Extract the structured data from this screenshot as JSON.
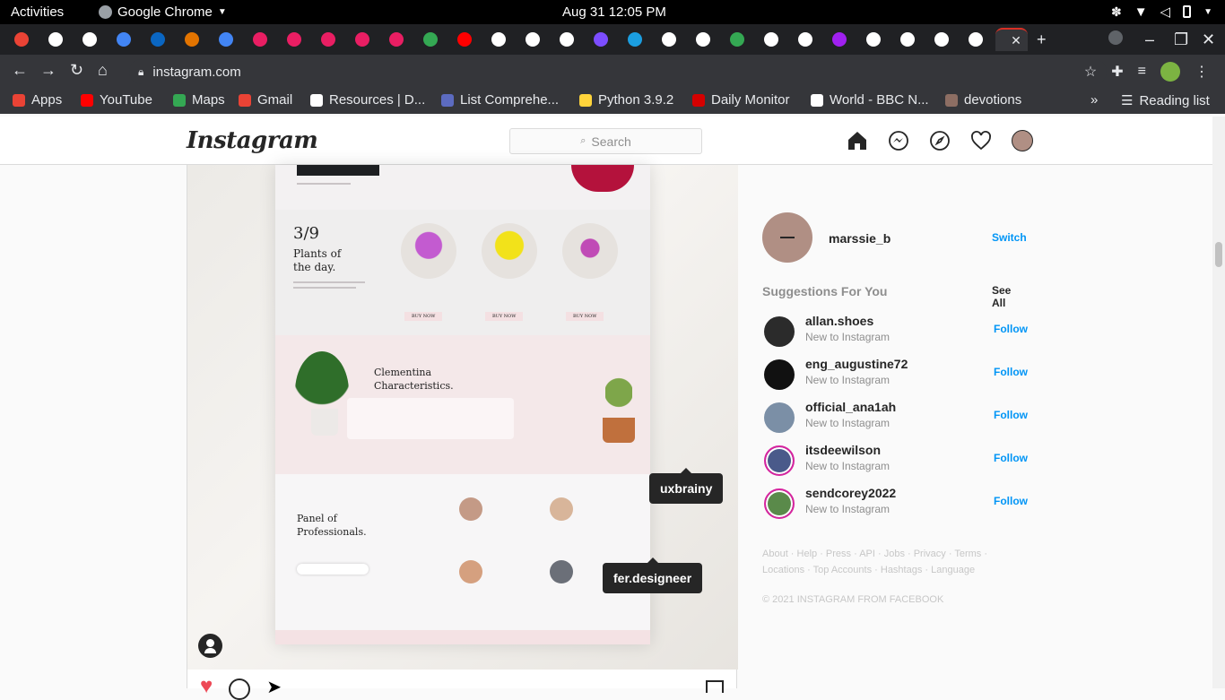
{
  "system": {
    "activities": "Activities",
    "app_name": "Google Chrome",
    "clock": "Aug 31  12:05 PM"
  },
  "browser": {
    "tab_colors": [
      "#ea4335",
      "#ffffff",
      "#ffffff",
      "#4285f4",
      "#0a66c2",
      "#e37400",
      "#4285f4",
      "#e91e63",
      "#e91e63",
      "#e91e63",
      "#e91e63",
      "#e91e63",
      "#34a853",
      "#ff0000",
      "#ffffff",
      "#ffffff",
      "#ffffff",
      "#7c4dff",
      "#1b9ee0",
      "#ffffff",
      "#ffffff",
      "#34a853",
      "#ffffff",
      "#ffffff",
      "#a020f0",
      "#ffffff",
      "#ffffff",
      "#ffffff",
      "#ffffff"
    ],
    "new_tab_icon": "plus-icon",
    "url": "instagram.com",
    "bookmarks": [
      {
        "label": "Apps",
        "color": "#ea4335"
      },
      {
        "label": "YouTube",
        "color": "#ff0000"
      },
      {
        "label": "Maps",
        "color": "#34a853"
      },
      {
        "label": "Gmail",
        "color": "#ea4335"
      },
      {
        "label": "Resources | D...",
        "color": "#ffffff"
      },
      {
        "label": "List Comprehe...",
        "color": "#5c6bc0"
      },
      {
        "label": "Python 3.9.2",
        "color": "#ffd43b"
      },
      {
        "label": "Daily Monitor",
        "color": "#d50000"
      },
      {
        "label": "World - BBC N...",
        "color": "#ffffff"
      },
      {
        "label": "devotions",
        "color": "#8d6e63"
      }
    ],
    "overflow": "»",
    "reading_list": "Reading list"
  },
  "instagram": {
    "logo": "Instagram",
    "search_placeholder": "Search",
    "post": {
      "tags": [
        "uxbrainy",
        "fer.designeer"
      ],
      "mockup": {
        "counter": "3/9",
        "plants_title": "Plants of the day.",
        "clementina": "Clementina Characteristics.",
        "panel": "Panel of Professionals.",
        "buy_now": "BUY NOW"
      }
    },
    "sidebar": {
      "username": "marssie_b",
      "switch": "Switch",
      "suggestions_title": "Suggestions For You",
      "see_all": "See All",
      "suggestions": [
        {
          "name": "allan.shoes",
          "sub": "New to Instagram",
          "action": "Follow",
          "avatar": "#2b2b2b"
        },
        {
          "name": "eng_augustine72",
          "sub": "New to Instagram",
          "action": "Follow",
          "avatar": "#111111"
        },
        {
          "name": "official_ana1ah",
          "sub": "New to Instagram",
          "action": "Follow",
          "avatar": "#7b8fa6"
        },
        {
          "name": "itsdeewilson",
          "sub": "New to Instagram",
          "action": "Follow",
          "avatar": "#4a5a8a"
        },
        {
          "name": "sendcorey2022",
          "sub": "New to Instagram",
          "action": "Follow",
          "avatar": "#5a8a4a"
        }
      ],
      "footer_line1": "About · Help · Press · API · Jobs · Privacy · Terms ·",
      "footer_line2": "Locations · Top Accounts · Hashtags · Language",
      "copyright": "© 2021 INSTAGRAM FROM FACEBOOK"
    }
  }
}
